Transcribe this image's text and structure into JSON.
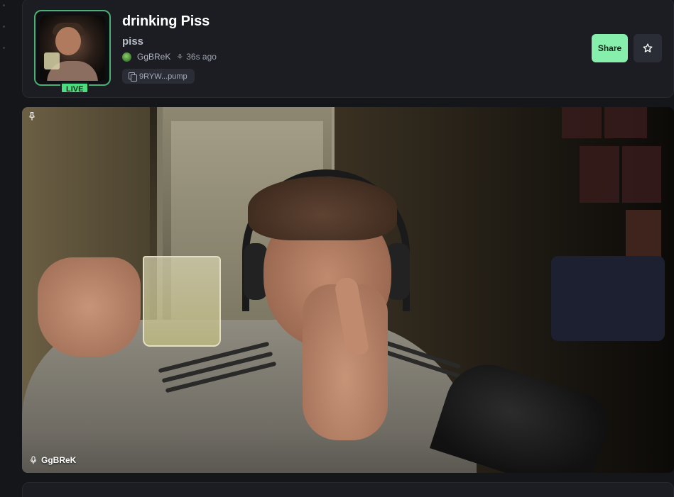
{
  "stream": {
    "title": "drinking Piss",
    "subtitle": "piss",
    "live_label": "LIVE",
    "creator": "GgBReK",
    "age": "36s ago",
    "address": "9RYW...pump"
  },
  "actions": {
    "share_label": "Share"
  },
  "video": {
    "speaker_name": "GgBReK"
  },
  "icons": {
    "pin": "pin-icon",
    "mic": "mic-icon",
    "star": "star-icon",
    "copy": "copy-icon",
    "sprout": "sprout-icon"
  },
  "colors": {
    "accent_green": "#4ade80",
    "share_bg": "#86efac",
    "card_bg": "#1b1d23",
    "page_bg": "#15161a"
  }
}
